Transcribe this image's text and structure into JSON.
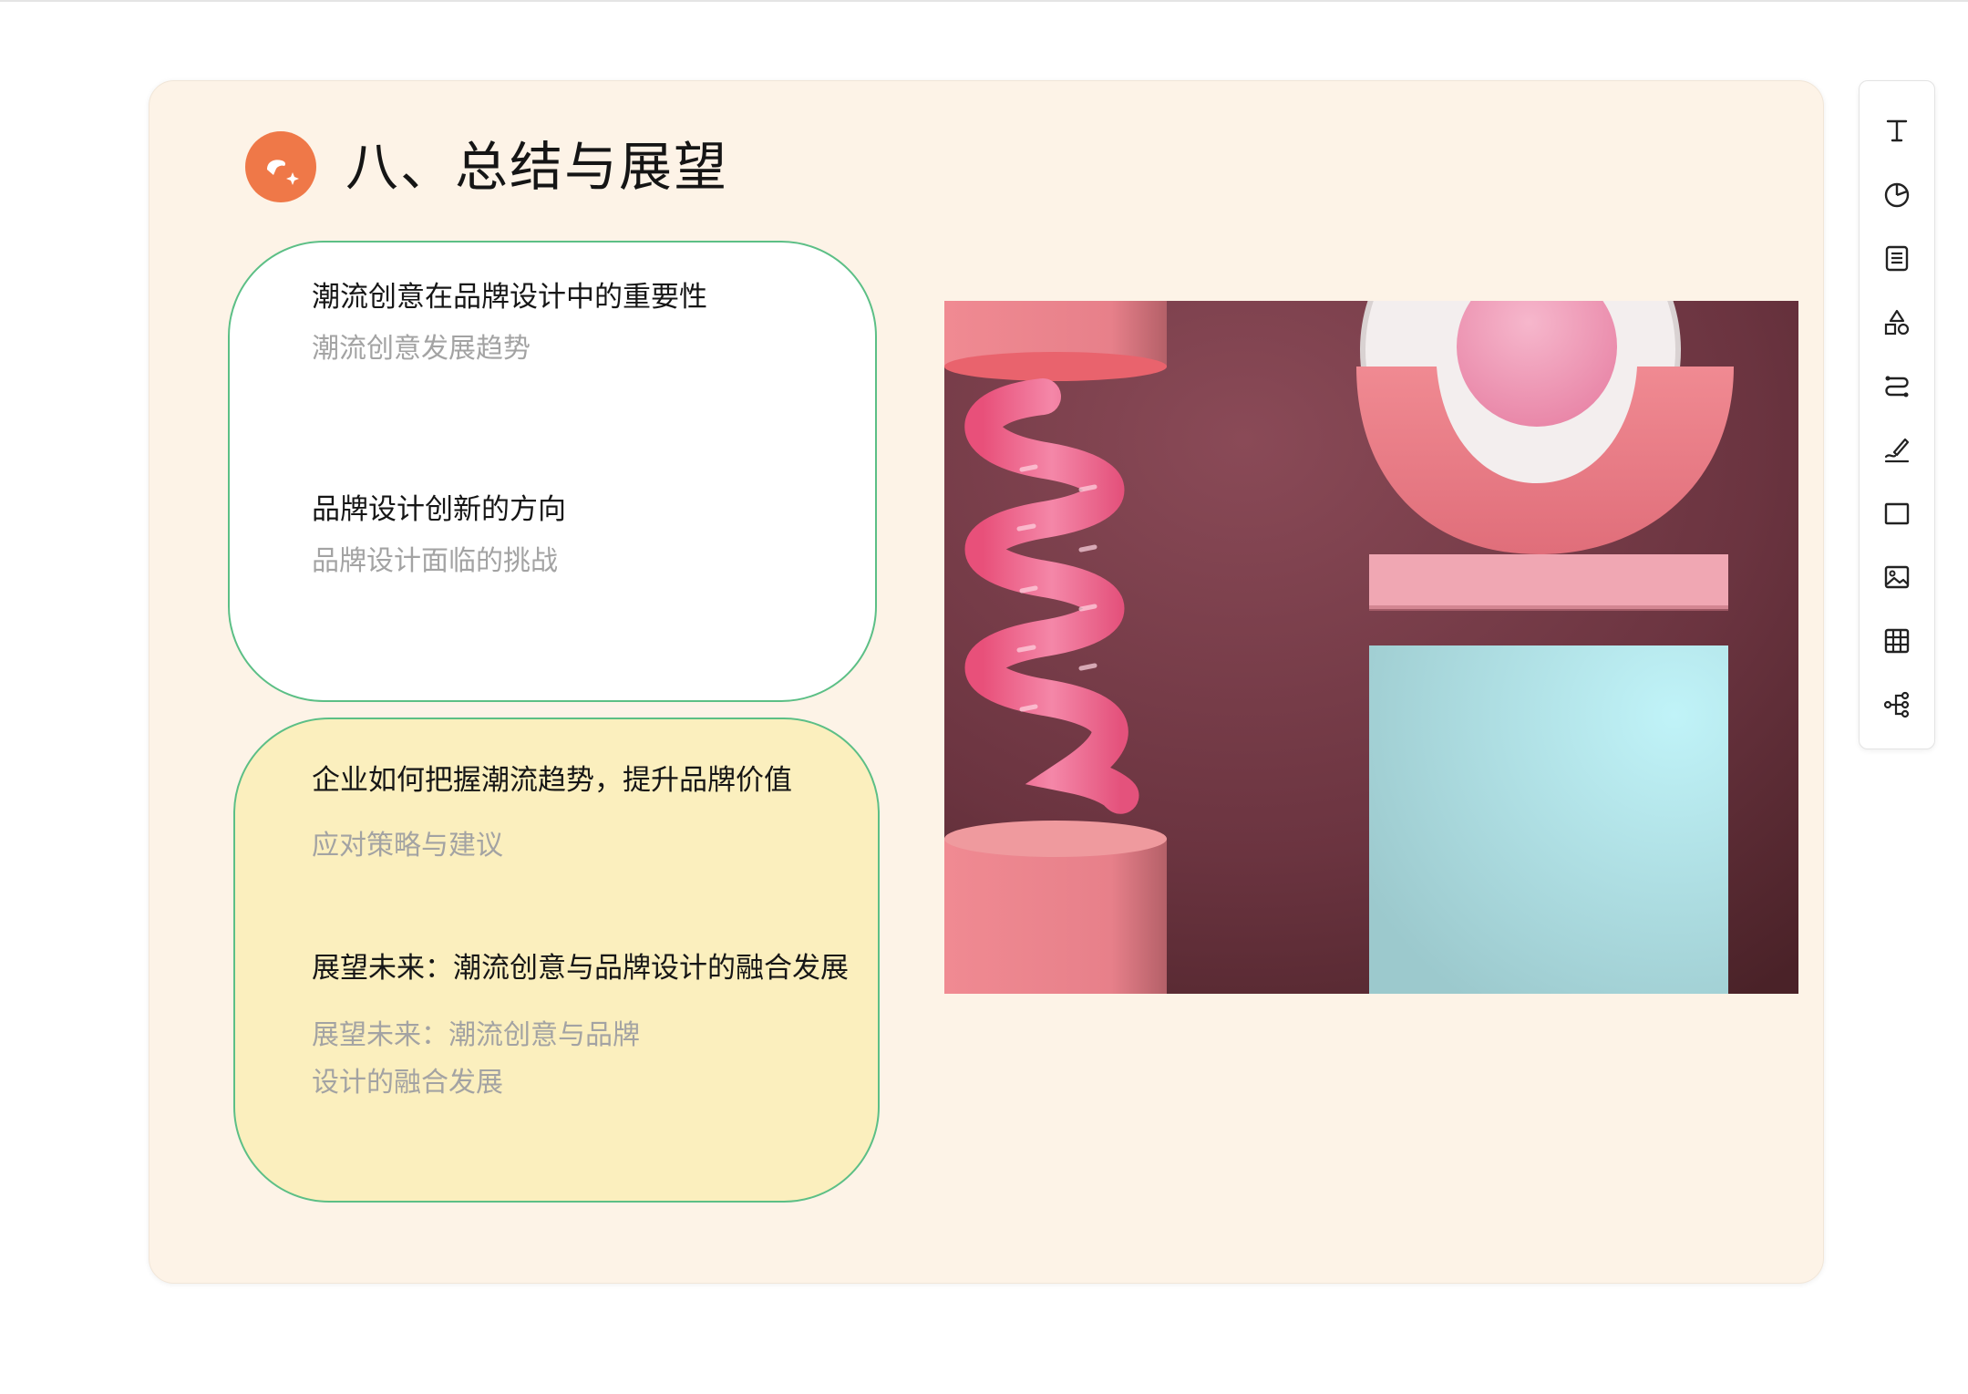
{
  "slide": {
    "title": "八、总结与展望",
    "logo_icon": "sparkle-bubble-icon",
    "accent_color": "#ef7848",
    "background_color": "#fdf3e7",
    "card_border_color": "#5cbf86"
  },
  "cards": [
    {
      "style": "white",
      "items": [
        {
          "heading": "潮流创意在品牌设计中的重要性",
          "sub": [
            "潮流创意发展趋势"
          ]
        },
        {
          "heading": "品牌设计创新的方向",
          "sub": [
            "品牌设计面临的挑战"
          ]
        }
      ]
    },
    {
      "style": "yellow",
      "items": [
        {
          "heading": "企业如何把握潮流趋势，提升品牌价值",
          "sub": [
            "应对策略与建议"
          ]
        },
        {
          "heading": "展望未来：潮流创意与品牌设计的融合发展",
          "sub": [
            "展望未来：潮流创意与品牌",
            "设计的融合发展"
          ]
        }
      ]
    }
  ],
  "image": {
    "description_icon": "abstract-3d-shapes-image"
  },
  "toolbar": {
    "tools": [
      {
        "icon": "text-icon"
      },
      {
        "icon": "pie-chart-icon"
      },
      {
        "icon": "document-icon"
      },
      {
        "icon": "shapes-icon"
      },
      {
        "icon": "connector-icon"
      },
      {
        "icon": "pen-icon"
      },
      {
        "icon": "rectangle-icon"
      },
      {
        "icon": "image-icon"
      },
      {
        "icon": "table-icon"
      },
      {
        "icon": "mindmap-icon"
      }
    ]
  }
}
